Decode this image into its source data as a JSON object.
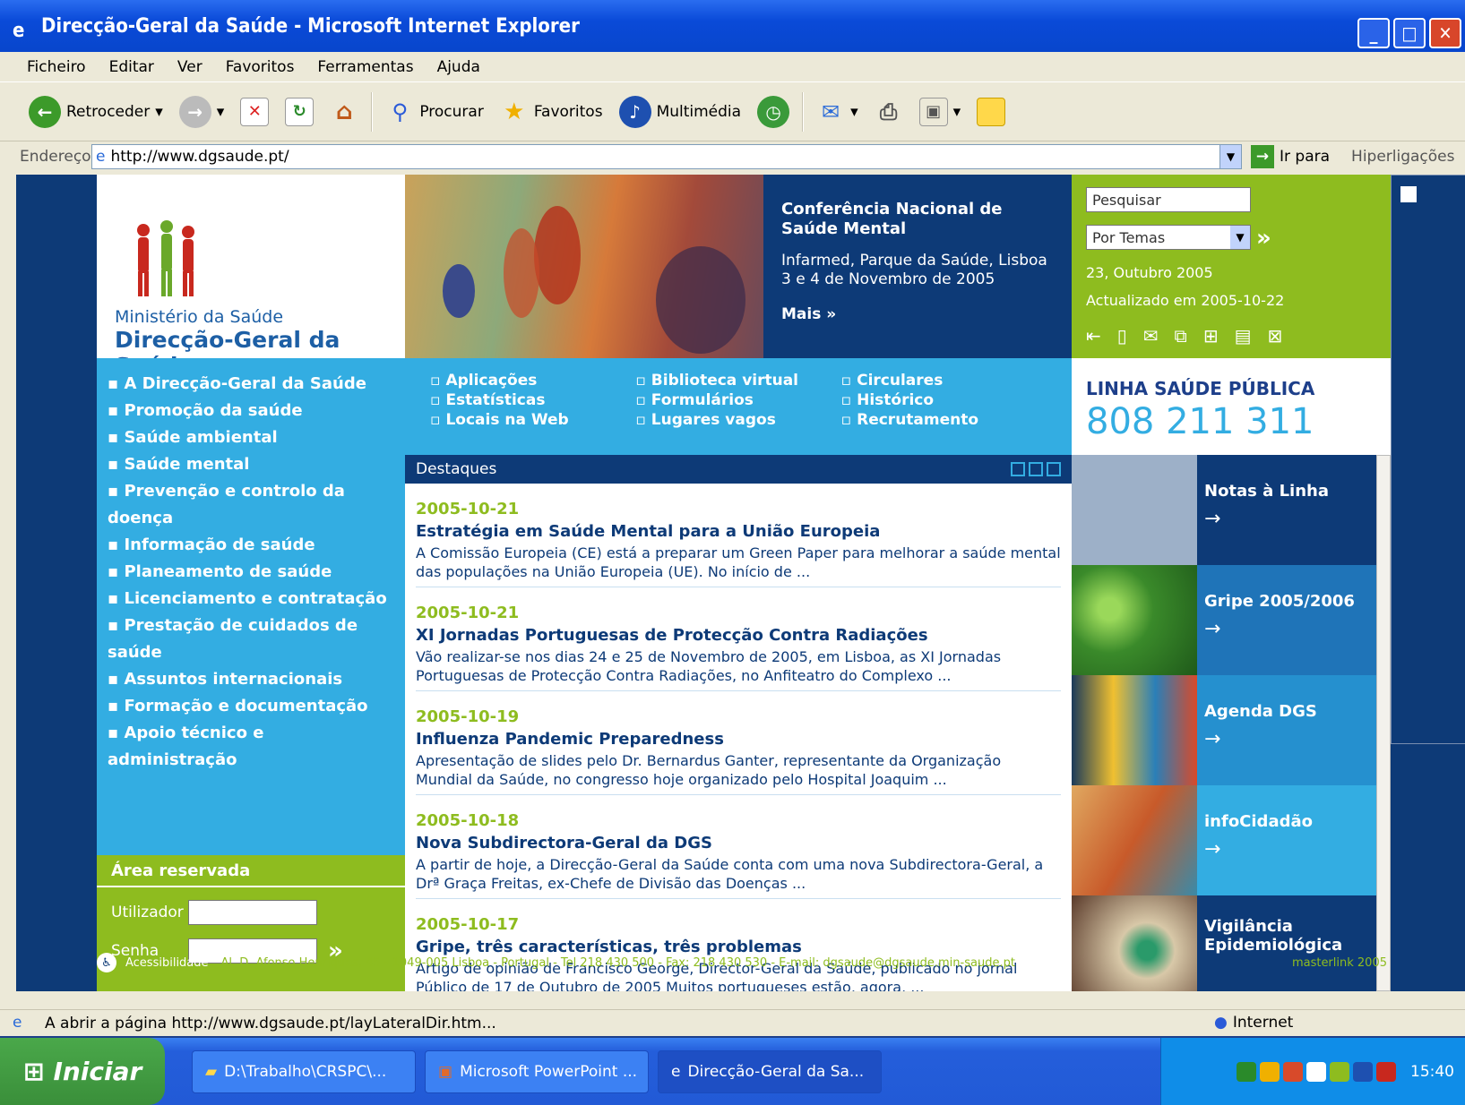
{
  "window": {
    "title": "Direcção-Geral da Saúde - Microsoft Internet Explorer"
  },
  "menu": [
    "Ficheiro",
    "Editar",
    "Ver",
    "Favoritos",
    "Ferramentas",
    "Ajuda"
  ],
  "toolbar": {
    "back": "Retroceder",
    "search": "Procurar",
    "favorites": "Favoritos",
    "media": "Multimédia"
  },
  "address": {
    "label": "Endereço",
    "url": "http://www.dgsaude.pt/",
    "go": "Ir para",
    "links": "Hiperligações"
  },
  "site": {
    "logo": {
      "ministry": "Ministério da Saúde",
      "dgs": "Direcção-Geral da Saúde"
    },
    "conference": {
      "title": "Conferência Nacional de Saúde Mental",
      "place": "Infarmed, Parque da Saúde, Lisboa",
      "dates": "3 e 4 de Novembro de 2005",
      "more": "Mais »"
    },
    "search": {
      "placeholder": "Pesquisar",
      "select": "Por Temas",
      "date": "23, Outubro 2005",
      "updated": "Actualizado em 2005-10-22"
    },
    "nav": [
      "A Direcção-Geral da Saúde",
      "Promoção da saúde",
      "Saúde ambiental",
      "Saúde mental",
      "Prevenção e controlo da doença",
      "Informação de saúde",
      "Planeamento de saúde",
      "Licenciamento e contratação",
      "Prestação de cuidados de saúde",
      "Assuntos internacionais",
      "Formação e documentação",
      "Apoio técnico e administração"
    ],
    "links": [
      [
        "Aplicações",
        "Estatísticas",
        "Locais na Web"
      ],
      [
        "Biblioteca virtual",
        "Formulários",
        "Lugares vagos"
      ],
      [
        "Circulares",
        "Histórico",
        "Recrutamento"
      ]
    ],
    "hotline": {
      "label": "LINHA SAÚDE PÚBLICA",
      "number": "808 211 311"
    },
    "news_header": "Destaques",
    "news": [
      {
        "date": "2005-10-21",
        "title": "Estratégia em Saúde Mental para a União Europeia",
        "text": "A Comissão Europeia (CE) está a preparar um Green Paper para melhorar a saúde mental das populações na União Europeia (UE). No início de ..."
      },
      {
        "date": "2005-10-21",
        "title": "XI Jornadas Portuguesas de Protecção Contra Radiações",
        "text": "Vão realizar-se nos dias 24 e 25 de Novembro de 2005, em Lisboa, as XI Jornadas Portuguesas de Protecção Contra Radiações, no Anfiteatro do Complexo ..."
      },
      {
        "date": "2005-10-19",
        "title": "Influenza Pandemic Preparedness",
        "text": "Apresentação de slides pelo Dr. Bernardus Ganter, representante da Organização Mundial da Saúde, no congresso hoje organizado pelo Hospital Joaquim ..."
      },
      {
        "date": "2005-10-18",
        "title": "Nova Subdirectora-Geral da DGS",
        "text": "A partir de hoje, a Direcção-Geral da Saúde conta com uma nova Subdirectora-Geral, a Drª Graça Freitas, ex-Chefe de Divisão das Doenças ..."
      },
      {
        "date": "2005-10-17",
        "title": "Gripe, três características, três problemas",
        "text": "Artigo de opinião de Francisco George, Director-Geral da Saúde, publicado no jornal Público de 17 de Outubro de 2005 Muitos portugueses estão, agora, ..."
      }
    ],
    "side": [
      {
        "label": "Notas à Linha",
        "color": "#0d3a77",
        "img": "#9db0c8"
      },
      {
        "label": "Gripe 2005/2006",
        "color": "#1f74b8",
        "img": "#5aa83a"
      },
      {
        "label": "Agenda DGS",
        "color": "#2590cf",
        "img": "#2a7fb8"
      },
      {
        "label": "infoCidadão",
        "color": "#33ade2",
        "img": "#c87a3a"
      },
      {
        "label": "Vigilância Epidemiológica",
        "color": "#0d3a77",
        "img": "#3a6a5a"
      }
    ],
    "reserved": {
      "title": "Área reservada",
      "user": "Utilizador",
      "pass": "Senha"
    },
    "footer": {
      "access": "Acessibilidade",
      "address": "Al. D. Afonso Henriques, 45 - 1049-005 Lisboa - Portugal - Tel 218 430 500 - Fax: 218 430 530 - E-mail: dgsaude@dgsaude.min-saude.pt",
      "brand": "masterlink 2005"
    }
  },
  "status": {
    "text": "A abrir a página http://www.dgsaude.pt/layLateralDir.htm...",
    "zone": "Internet"
  },
  "taskbar": {
    "start": "Iniciar",
    "tasks": [
      "D:\\Trabalho\\CRSPC\\...",
      "Microsoft PowerPoint ...",
      "Direcção-Geral da Sa..."
    ],
    "clock": "15:40"
  }
}
